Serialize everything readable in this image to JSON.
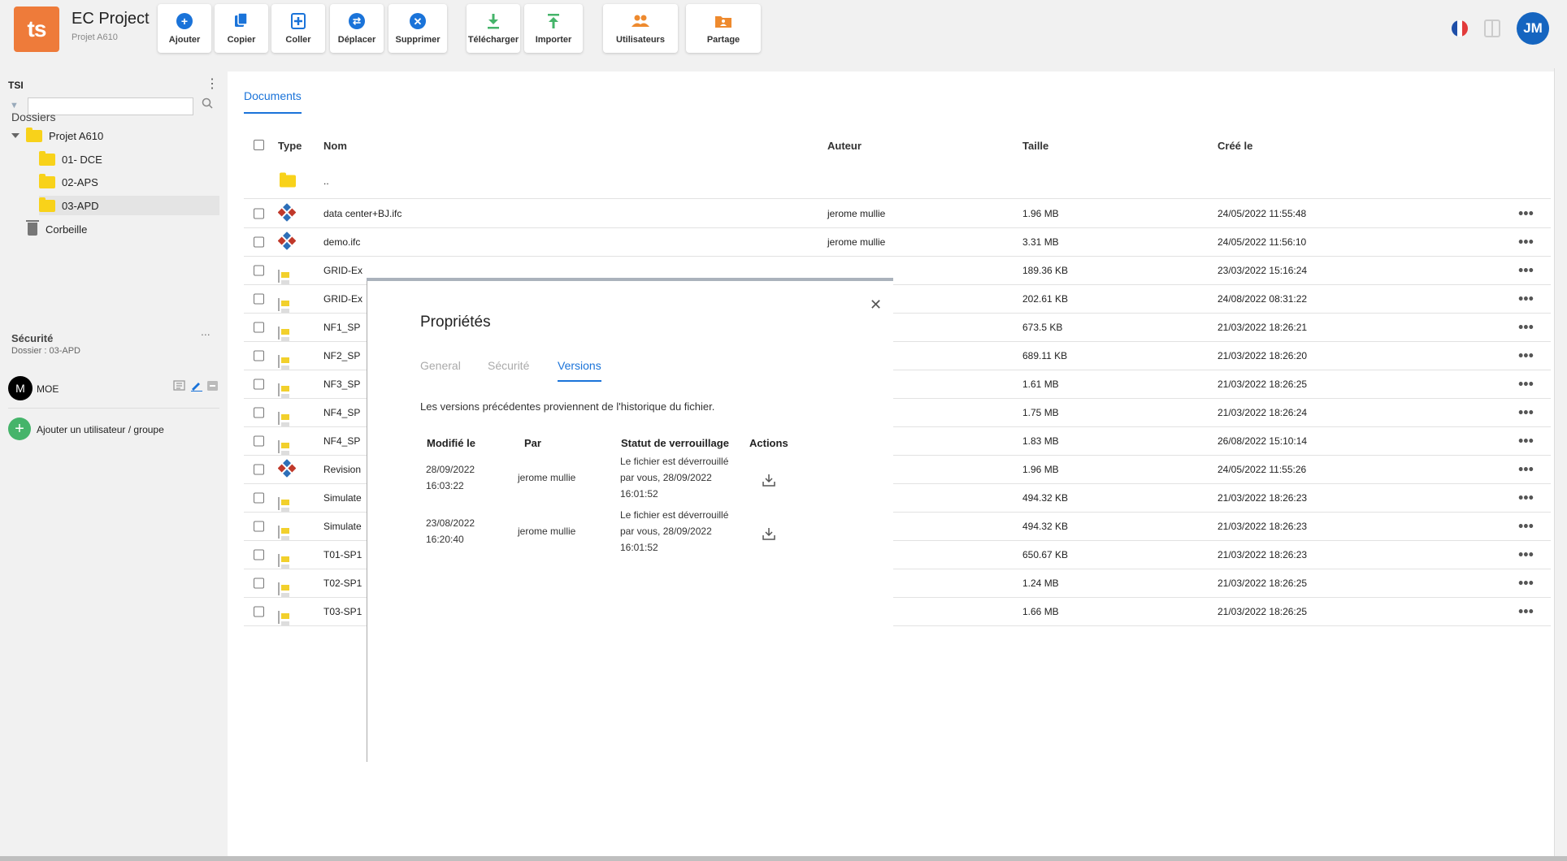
{
  "app": {
    "logo_text": "ts",
    "title": "EC Project",
    "subtitle": "Projet A610",
    "user_initials": "JM"
  },
  "toolbar": {
    "add_label": "Ajouter",
    "copy_label": "Copier",
    "paste_label": "Coller",
    "move_label": "Déplacer",
    "delete_label": "Supprimer",
    "download_label": "Télécharger",
    "import_label": "Importer",
    "users_label": "Utilisateurs",
    "share_label": "Partage"
  },
  "sidebar": {
    "header": "TSI",
    "search_placeholder": "",
    "folders_title": "Dossiers",
    "root_folder": "Projet A610",
    "folders": [
      "01- DCE",
      "02-APS",
      "03-APD"
    ],
    "trash_label": "Corbeille",
    "security_title": "Sécurité",
    "security_more": "...",
    "security_folder": "Dossier : 03-APD",
    "member_initial": "M",
    "member_name": "MOE",
    "add_member_label": "Ajouter un utilisateur / groupe"
  },
  "documents": {
    "tab_label": "Documents",
    "columns": {
      "type": "Type",
      "name": "Nom",
      "author": "Auteur",
      "size": "Taille",
      "created": "Créé le"
    },
    "parent_row": "..",
    "rows": [
      {
        "icon": "ifc",
        "name": "data center+BJ.ifc",
        "author": "jerome mullie",
        "size": "1.96 MB",
        "created": "24/05/2022 11:55:48"
      },
      {
        "icon": "ifc",
        "name": "demo.ifc",
        "author": "jerome mullie",
        "size": "3.31 MB",
        "created": "24/05/2022 11:56:10"
      },
      {
        "icon": "gif",
        "name": "GRID-Ex",
        "author": "",
        "size": "189.36 KB",
        "created": "23/03/2022 15:16:24"
      },
      {
        "icon": "gif",
        "name": "GRID-Ex",
        "author": "",
        "size": "202.61 KB",
        "created": "24/08/2022 08:31:22"
      },
      {
        "icon": "gif",
        "name": "NF1_SP",
        "author": "",
        "size": "673.5 KB",
        "created": "21/03/2022 18:26:21"
      },
      {
        "icon": "gif",
        "name": "NF2_SP",
        "author": "",
        "size": "689.11 KB",
        "created": "21/03/2022 18:26:20"
      },
      {
        "icon": "gif",
        "name": "NF3_SP",
        "author": "",
        "size": "1.61 MB",
        "created": "21/03/2022 18:26:25"
      },
      {
        "icon": "gif",
        "name": "NF4_SP",
        "author": "",
        "size": "1.75 MB",
        "created": "21/03/2022 18:26:24"
      },
      {
        "icon": "gif",
        "name": "NF4_SP",
        "author": "",
        "size": "1.83 MB",
        "created": "26/08/2022 15:10:14"
      },
      {
        "icon": "ifc",
        "name": "Revision",
        "author": "",
        "size": "1.96 MB",
        "created": "24/05/2022 11:55:26"
      },
      {
        "icon": "gif",
        "name": "Simulate",
        "author": "",
        "size": "494.32 KB",
        "created": "21/03/2022 18:26:23"
      },
      {
        "icon": "gif",
        "name": "Simulate",
        "author": "",
        "size": "494.32 KB",
        "created": "21/03/2022 18:26:23"
      },
      {
        "icon": "gif",
        "name": "T01-SP1",
        "author": "",
        "size": "650.67 KB",
        "created": "21/03/2022 18:26:23"
      },
      {
        "icon": "gif",
        "name": "T02-SP1",
        "author": "",
        "size": "1.24 MB",
        "created": "21/03/2022 18:26:25"
      },
      {
        "icon": "gif",
        "name": "T03-SP1",
        "author": "",
        "size": "1.66 MB",
        "created": "21/03/2022 18:26:25"
      }
    ],
    "more_label": "•••"
  },
  "modal": {
    "title": "Propriétés",
    "close_label": "✕",
    "tabs": [
      "General",
      "Sécurité",
      "Versions"
    ],
    "active_tab": "Versions",
    "description": "Les versions précédentes proviennent de l'historique du fichier.",
    "columns": {
      "modified": "Modifié le",
      "by": "Par",
      "lock_status": "Statut de verrouillage",
      "actions": "Actions"
    },
    "versions": [
      {
        "date": "28/09/2022",
        "time": "16:03:22",
        "by": "jerome mullie",
        "status_line1": "Le fichier est déverrouillé",
        "status_line2": "par vous, 28/09/2022",
        "status_line3": "16:01:52"
      },
      {
        "date": "23/08/2022",
        "time": "16:20:40",
        "by": "jerome mullie",
        "status_line1": "Le fichier est déverrouillé",
        "status_line2": "par vous, 28/09/2022",
        "status_line3": "16:01:52"
      }
    ]
  },
  "colors": {
    "accent": "#1a73d9",
    "logo": "#ee7b3a",
    "folder": "#f8d21a",
    "add_green": "#45b46a",
    "avatar": "#1565c0"
  }
}
